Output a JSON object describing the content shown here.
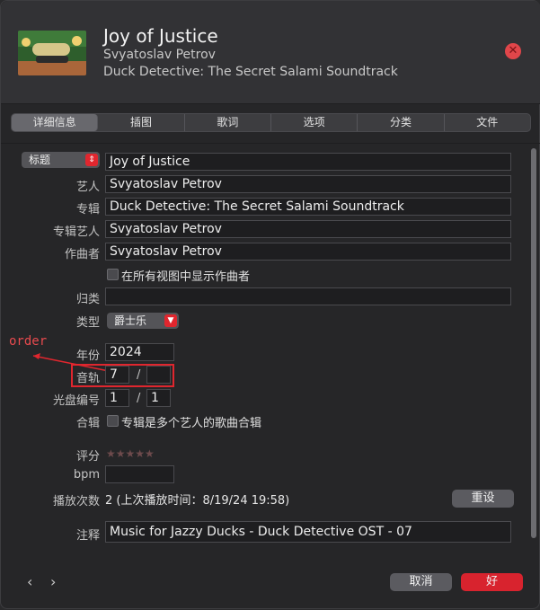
{
  "header": {
    "title": "Joy of Justice",
    "artist": "Svyatoslav Petrov",
    "album": "Duck Detective: The Secret Salami Soundtrack",
    "close_icon": "close-icon"
  },
  "tabs": [
    {
      "label": "详细信息",
      "active": true
    },
    {
      "label": "插图",
      "active": false
    },
    {
      "label": "歌词",
      "active": false
    },
    {
      "label": "选项",
      "active": false
    },
    {
      "label": "分类",
      "active": false
    },
    {
      "label": "文件",
      "active": false
    }
  ],
  "form": {
    "title_selector": "标题",
    "title_value": "Joy of Justice",
    "artist_label": "艺人",
    "artist_value": "Svyatoslav Petrov",
    "album_label": "专辑",
    "album_value": "Duck Detective: The Secret Salami Soundtrack",
    "album_artist_label": "专辑艺人",
    "album_artist_value": "Svyatoslav Petrov",
    "composer_label": "作曲者",
    "composer_value": "Svyatoslav Petrov",
    "show_composer_label": "在所有视图中显示作曲者",
    "grouping_label": "归类",
    "grouping_value": "",
    "genre_label": "类型",
    "genre_value": "爵士乐",
    "year_label": "年份",
    "year_value": "2024",
    "track_label": "音轨",
    "track_number": "7",
    "track_total": "",
    "track_slash": "/",
    "disc_label": "光盘编号",
    "disc_number": "1",
    "disc_total": "1",
    "disc_slash": "/",
    "compilation_label": "合辑",
    "compilation_text": "专辑是多个艺人的歌曲合辑",
    "rating_label": "评分",
    "rating_stars": "★★★★★",
    "rating_value": 0,
    "bpm_label": "bpm",
    "bpm_value": "",
    "plays_label": "播放次数",
    "plays_value": "2 (上次播放时间：8/19/24 19:58)",
    "reset_label": "重设",
    "comments_label": "注释",
    "comments_value": "Music for Jazzy Ducks - Duck Detective OST - 07"
  },
  "annotation": {
    "text": "order",
    "color": "#e0262e"
  },
  "footer": {
    "prev_icon": "chevron-left-icon",
    "next_icon": "chevron-right-icon",
    "cancel_label": "取消",
    "ok_label": "好"
  },
  "colors": {
    "accent_red": "#e0262e",
    "ok_button": "#d8232e",
    "background": "#262628"
  }
}
